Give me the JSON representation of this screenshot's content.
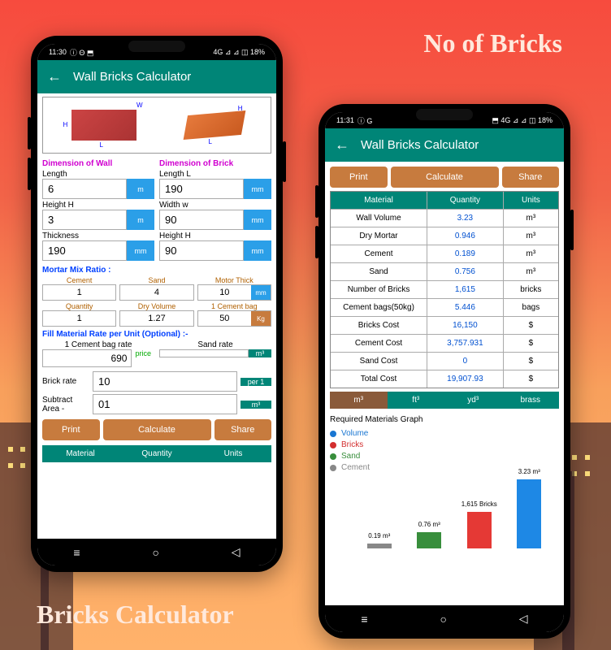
{
  "headings": {
    "top": "No of Bricks",
    "bottom": "Bricks Calculator"
  },
  "status": {
    "time1": "11:30",
    "icons1": "ⓘ Θ ⬒",
    "right1": "4G ⊿ ⊿ ◫ 18%",
    "time2": "11:31",
    "icons2": "ⓘ G",
    "right2": "⬒ 4G ⊿ ⊿ ◫ 18%"
  },
  "app": {
    "title": "Wall Bricks Calculator",
    "back": "←"
  },
  "sections": {
    "wall": "Dimension of Wall",
    "brick": "Dimension of Brick",
    "mortar": "Mortar Mix Ratio :",
    "rate": "Fill Material Rate per Unit (Optional) :-"
  },
  "fields": {
    "length": {
      "label": "Length",
      "value": "6",
      "unit": "m"
    },
    "heightH": {
      "label": "Height H",
      "value": "3",
      "unit": "m"
    },
    "thickness": {
      "label": "Thickness",
      "value": "190",
      "unit": "mm"
    },
    "lengthL": {
      "label": "Length L",
      "value": "190",
      "unit": "mm"
    },
    "widthW": {
      "label": "Width w",
      "value": "90",
      "unit": "mm"
    },
    "heightH2": {
      "label": "Height H",
      "value": "90",
      "unit": "mm"
    }
  },
  "mortar": {
    "cement": {
      "label": "Cement",
      "value": "1"
    },
    "sand": {
      "label": "Sand",
      "value": "4"
    },
    "mortarThick": {
      "label": "Motor Thick",
      "value": "10",
      "unit": "mm"
    },
    "quantity": {
      "label": "Quantity",
      "value": "1"
    },
    "dryVolume": {
      "label": "Dry Volume",
      "value": "1.27"
    },
    "cementBag": {
      "label": "1 Cement bag",
      "value": "50",
      "unit": "Kg"
    }
  },
  "rates": {
    "cementBagRate": {
      "label": "1 Cement bag rate",
      "value": "690",
      "tag": "price"
    },
    "sandRate": {
      "label": "Sand rate",
      "value": "",
      "unit": "m³"
    },
    "brickRate": {
      "label": "Brick rate",
      "value": "10",
      "unit": "per 1"
    },
    "subtractArea": {
      "label": "Subtract Area -",
      "value": "01",
      "unit": "m³"
    }
  },
  "actions": {
    "print": "Print",
    "calculate": "Calculate",
    "share": "Share"
  },
  "tableHead": {
    "c1": "Material",
    "c2": "Quantity",
    "c3": "Units"
  },
  "results": [
    {
      "m": "Wall Volume",
      "q": "3.23",
      "u": "m³"
    },
    {
      "m": "Dry Mortar",
      "q": "0.946",
      "u": "m³"
    },
    {
      "m": "Cement",
      "q": "0.189",
      "u": "m³"
    },
    {
      "m": "Sand",
      "q": "0.756",
      "u": "m³"
    },
    {
      "m": "Number of Bricks",
      "q": "1,615",
      "u": "bricks"
    },
    {
      "m": "Cement bags(50kg)",
      "q": "5.446",
      "u": "bags"
    },
    {
      "m": "Bricks Cost",
      "q": "16,150",
      "u": "$"
    },
    {
      "m": "Cement Cost",
      "q": "3,757.931",
      "u": "$"
    },
    {
      "m": "Sand Cost",
      "q": "0",
      "u": "$"
    },
    {
      "m": "Total Cost",
      "q": "19,907.93",
      "u": "$"
    }
  ],
  "unitTabs": {
    "t1": "m³",
    "t2": "ft³",
    "t3": "yd³",
    "t4": "brass"
  },
  "graph": {
    "title": "Required Materials Graph",
    "legend": {
      "volume": "Volume",
      "bricks": "Bricks",
      "sand": "Sand",
      "cement": "Cement"
    }
  },
  "chart_data": {
    "type": "bar",
    "categories": [
      "Cement",
      "Sand",
      "Bricks",
      "Volume"
    ],
    "values": [
      0.19,
      0.76,
      1615,
      3.23
    ],
    "labels": [
      "0.19 m³",
      "0.76 m³",
      "1,615 Bricks",
      "3.23 m³"
    ],
    "colors": [
      "#888",
      "#388e3c",
      "#e53935",
      "#1e88e5"
    ],
    "title": "Required Materials Graph"
  }
}
